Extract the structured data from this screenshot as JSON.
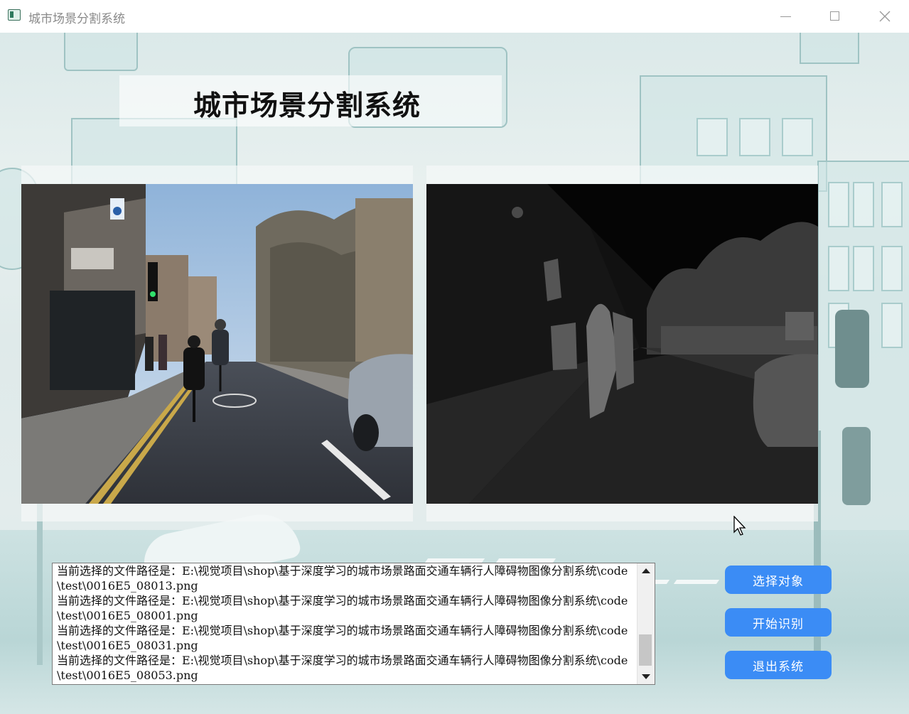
{
  "window": {
    "title": "城市场景分割系统"
  },
  "header": {
    "title": "城市场景分割系统"
  },
  "panels": {
    "original": {
      "content": "street-photo"
    },
    "segmented": {
      "content": "segmentation-mask"
    }
  },
  "log": {
    "lines": [
      "当前选择的文件路径是：E:\\视觉项目\\shop\\基于深度学习的城市场景路面交通车辆行人障碍物图像分割系统\\code\\test\\0016E5_08013.png",
      "当前选择的文件路径是：E:\\视觉项目\\shop\\基于深度学习的城市场景路面交通车辆行人障碍物图像分割系统\\code\\test\\0016E5_08001.png",
      "当前选择的文件路径是：E:\\视觉项目\\shop\\基于深度学习的城市场景路面交通车辆行人障碍物图像分割系统\\code\\test\\0016E5_08031.png",
      "当前选择的文件路径是：E:\\视觉项目\\shop\\基于深度学习的城市场景路面交通车辆行人障碍物图像分割系统\\code\\test\\0016E5_08053.png"
    ]
  },
  "buttons": {
    "select": "选择对象",
    "start": "开始识别",
    "exit": "退出系统"
  },
  "colors": {
    "button": "#3b8cf5",
    "background": "#dfeaea"
  }
}
